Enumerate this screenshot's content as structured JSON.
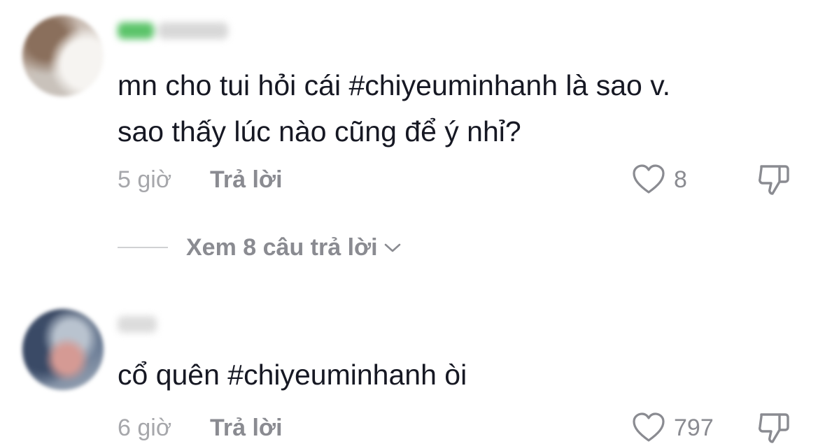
{
  "comments": [
    {
      "text": "mn cho tui hỏi cái #chiyeuminhanh là sao v.\nsao thấy lúc nào cũng để ý nhỉ?",
      "time": "5 giờ",
      "reply_label": "Trả lời",
      "likes": "8",
      "view_replies_label": "Xem 8 câu trả lời"
    },
    {
      "text": "cổ quên #chiyeuminhanh òi",
      "time": "6 giờ",
      "reply_label": "Trả lời",
      "likes": "797"
    }
  ],
  "icons": {
    "like": "heart-outline-icon",
    "dislike": "thumbs-down-outline-icon",
    "expand": "chevron-down-icon"
  },
  "colors": {
    "text": "#161823",
    "muted": "#8a8b91",
    "timestamp": "#a6a7ab"
  }
}
